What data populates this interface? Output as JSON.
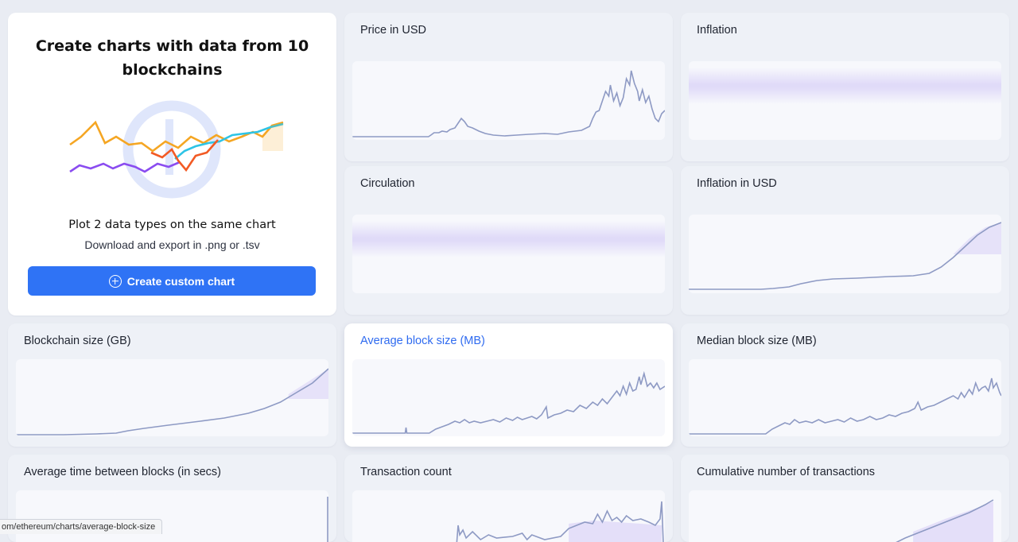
{
  "promo": {
    "title": "Create charts with data from 10 blockchains",
    "subtitle": "Plot 2 data types on the same chart",
    "description": "Download and export in .png or .tsv",
    "button_label": "Create custom chart",
    "icon": "plus-circle-icon",
    "illustration_icon": "blockchair-logo-icon",
    "line_colors": [
      "#f5a623",
      "#2ec4e6",
      "#8a4cf0",
      "#f25a24"
    ]
  },
  "cards": [
    {
      "id": "price",
      "title": "Price in USD",
      "highlighted": false
    },
    {
      "id": "inflation",
      "title": "Inflation",
      "highlighted": false
    },
    {
      "id": "circulation",
      "title": "Circulation",
      "highlighted": false
    },
    {
      "id": "inflation-usd",
      "title": "Inflation in USD",
      "highlighted": false
    },
    {
      "id": "blockchain-size",
      "title": "Blockchain size (GB)",
      "highlighted": false
    },
    {
      "id": "avg-block-size",
      "title": "Average block size (MB)",
      "highlighted": true
    },
    {
      "id": "median-block-size",
      "title": "Median block size (MB)",
      "highlighted": false
    },
    {
      "id": "avg-time",
      "title": "Average time between blocks (in secs)",
      "highlighted": false
    },
    {
      "id": "tx-count",
      "title": "Transaction count",
      "highlighted": false
    },
    {
      "id": "cumulative-tx",
      "title": "Cumulative number of transactions",
      "highlighted": false
    }
  ],
  "colors": {
    "accent": "#2f73f5",
    "line": "#8e9ac4",
    "band": "#ded8f8",
    "background": "#e9ecf3"
  },
  "status_bar": {
    "url": "om/ethereum/charts/average-block-size"
  }
}
